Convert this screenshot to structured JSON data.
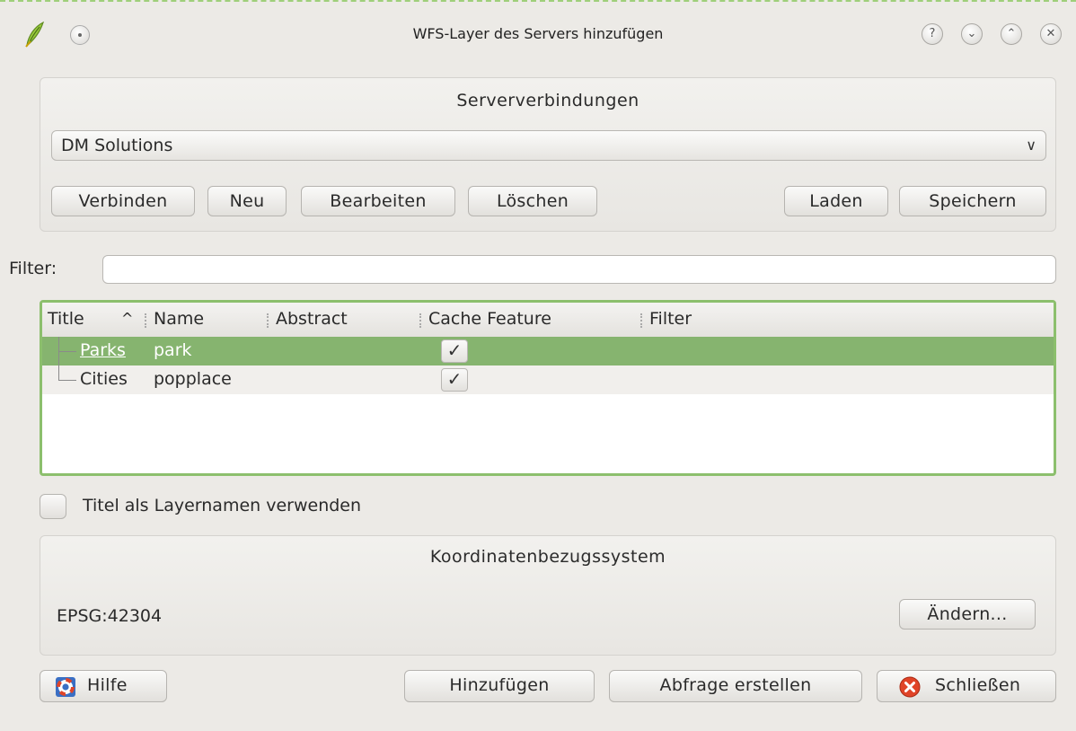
{
  "window": {
    "title": "WFS-Layer des Servers hinzufügen",
    "controls": [
      "?",
      "⌄",
      "⌃",
      "✕"
    ]
  },
  "server": {
    "group_title": "Serververbindungen",
    "selected_connection": "DM Solutions",
    "buttons": {
      "connect": "Verbinden",
      "new": "Neu",
      "edit": "Bearbeiten",
      "delete": "Löschen",
      "load": "Laden",
      "save": "Speichern"
    }
  },
  "filter": {
    "label": "Filter:",
    "value": ""
  },
  "table": {
    "columns": [
      "Title",
      "Name",
      "Abstract",
      "Cache Feature",
      "Filter"
    ],
    "sort_indicator": "^",
    "rows": [
      {
        "title": "Parks",
        "name": "park",
        "cache_feature": true,
        "selected": true
      },
      {
        "title": "Cities",
        "name": "popplace",
        "cache_feature": true,
        "selected": false
      }
    ]
  },
  "options": {
    "use_title_label": "Titel als Layernamen verwenden",
    "use_title_checked": false
  },
  "crs": {
    "group_title": "Koordinatenbezugssystem",
    "value": "EPSG:42304",
    "change_button": "Ändern..."
  },
  "footer": {
    "help": "Hilfe",
    "add": "Hinzufügen",
    "build_query": "Abfrage erstellen",
    "close": "Schließen"
  },
  "colors": {
    "selection": "#86b46f",
    "focus_border": "#8cbf6d",
    "close_icon": "#e04428"
  }
}
